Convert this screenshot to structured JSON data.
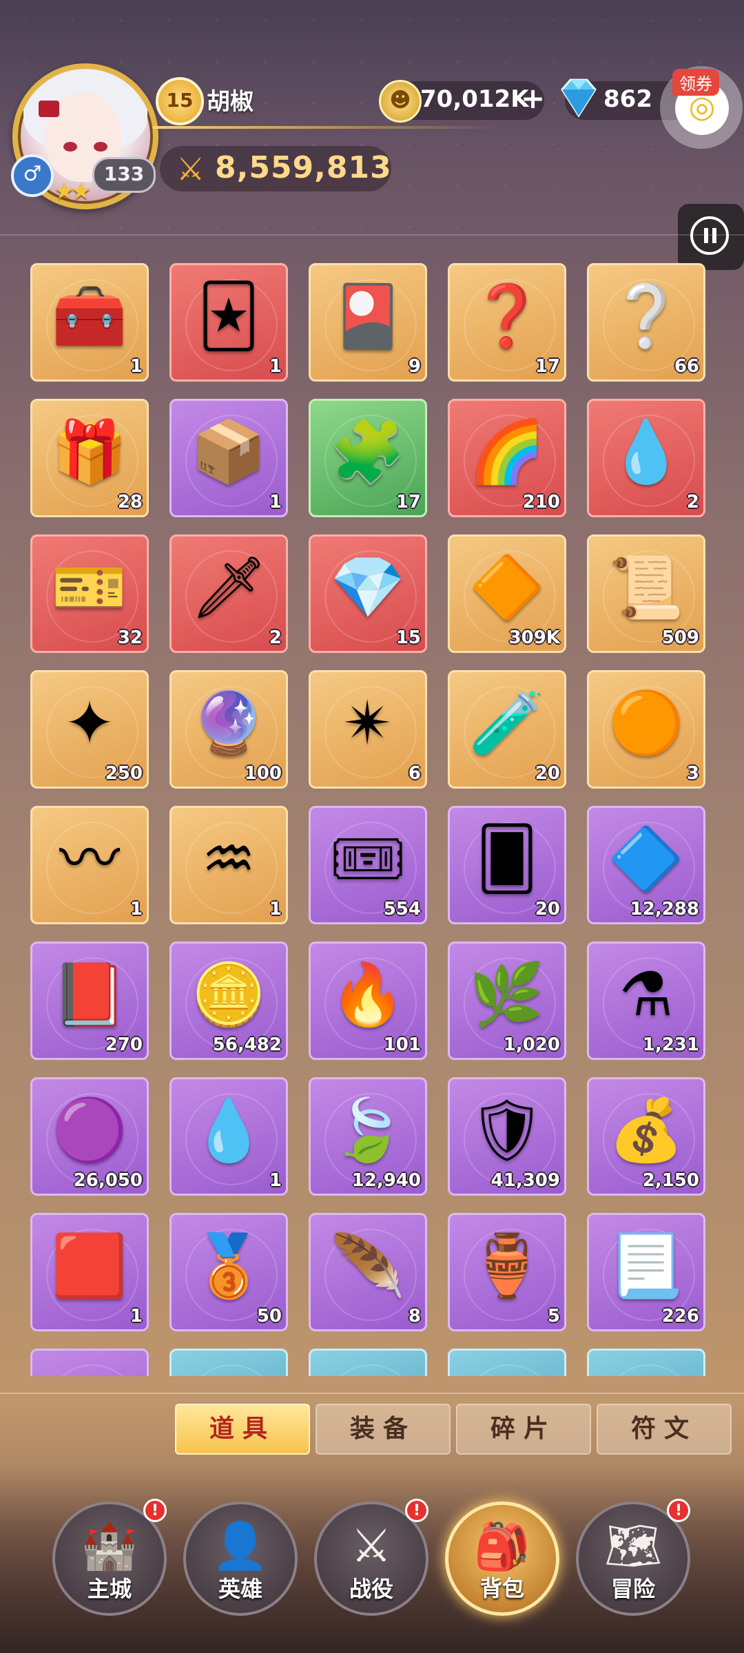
{
  "player": {
    "level": "15",
    "name": "胡椒",
    "hero_power_badge": "133",
    "total_power": "8,559,813"
  },
  "currency": {
    "gold": "70,012K",
    "gems": "862",
    "coupon_label": "领券"
  },
  "inventory": [
    {
      "icon": "treasure-chest",
      "glyph": "🧰",
      "count": "1",
      "rarity": "orange"
    },
    {
      "icon": "tarot-card",
      "glyph": "🃏",
      "count": "1",
      "rarity": "red"
    },
    {
      "icon": "hero-card-pack",
      "glyph": "🎴",
      "count": "9",
      "rarity": "orange"
    },
    {
      "icon": "mystery-card-pack",
      "glyph": "❓",
      "count": "17",
      "rarity": "orange"
    },
    {
      "icon": "mystery-card-pack-large",
      "glyph": "❔",
      "count": "66",
      "rarity": "orange"
    },
    {
      "icon": "golden-mystery-chest",
      "glyph": "🎁",
      "count": "28",
      "rarity": "orange"
    },
    {
      "icon": "purple-chest",
      "glyph": "📦",
      "count": "1",
      "rarity": "purple"
    },
    {
      "icon": "green-chest",
      "glyph": "🧩",
      "count": "17",
      "rarity": "green"
    },
    {
      "icon": "rainbow-card",
      "glyph": "🌈",
      "count": "210",
      "rarity": "red"
    },
    {
      "icon": "purple-drop",
      "glyph": "💧",
      "count": "2",
      "rarity": "red"
    },
    {
      "icon": "voucher-ticket",
      "glyph": "🎫",
      "count": "32",
      "rarity": "red"
    },
    {
      "icon": "spear",
      "glyph": "🗡",
      "count": "2",
      "rarity": "red"
    },
    {
      "icon": "blue-crystal",
      "glyph": "💎",
      "count": "15",
      "rarity": "red"
    },
    {
      "icon": "red-crystal",
      "glyph": "🔶",
      "count": "309K",
      "rarity": "orange"
    },
    {
      "icon": "summon-scroll",
      "glyph": "📜",
      "count": "509",
      "rarity": "orange"
    },
    {
      "icon": "blue-star",
      "glyph": "✦",
      "count": "250",
      "rarity": "orange"
    },
    {
      "icon": "purple-crystal-shard",
      "glyph": "🔮",
      "count": "100",
      "rarity": "orange"
    },
    {
      "icon": "rainbow-star",
      "glyph": "✴",
      "count": "6",
      "rarity": "orange"
    },
    {
      "icon": "potion-vial",
      "glyph": "🧪",
      "count": "20",
      "rarity": "orange"
    },
    {
      "icon": "amber-stone",
      "glyph": "🟠",
      "count": "3",
      "rarity": "orange"
    },
    {
      "icon": "blue-rune",
      "glyph": "〰",
      "count": "1",
      "rarity": "orange"
    },
    {
      "icon": "green-rune",
      "glyph": "♒",
      "count": "1",
      "rarity": "orange"
    },
    {
      "icon": "ticket-book",
      "glyph": "🎟",
      "count": "554",
      "rarity": "purple"
    },
    {
      "icon": "blue-summon-card",
      "glyph": "🂠",
      "count": "20",
      "rarity": "purple"
    },
    {
      "icon": "purple-shards",
      "glyph": "🔷",
      "count": "12,288",
      "rarity": "purple"
    },
    {
      "icon": "red-book",
      "glyph": "📕",
      "count": "270",
      "rarity": "purple"
    },
    {
      "icon": "gold-coin",
      "glyph": "🪙",
      "count": "56,482",
      "rarity": "purple"
    },
    {
      "icon": "campfire",
      "glyph": "🔥",
      "count": "101",
      "rarity": "purple"
    },
    {
      "icon": "golden-branch",
      "glyph": "🌿",
      "count": "1,020",
      "rarity": "purple"
    },
    {
      "icon": "potion-bottle",
      "glyph": "⚗",
      "count": "1,231",
      "rarity": "purple"
    },
    {
      "icon": "purple-gem",
      "glyph": "🟣",
      "count": "26,050",
      "rarity": "purple"
    },
    {
      "icon": "water-drop",
      "glyph": "💧",
      "count": "1",
      "rarity": "purple"
    },
    {
      "icon": "green-leaf",
      "glyph": "🍃",
      "count": "12,940",
      "rarity": "purple"
    },
    {
      "icon": "blue-medallion",
      "glyph": "🛡",
      "count": "41,309",
      "rarity": "purple"
    },
    {
      "icon": "gold-pouch",
      "glyph": "💰",
      "count": "2,150",
      "rarity": "purple"
    },
    {
      "icon": "carpet",
      "glyph": "🟥",
      "count": "1",
      "rarity": "purple"
    },
    {
      "icon": "bronze-coin",
      "glyph": "🥉",
      "count": "50",
      "rarity": "purple"
    },
    {
      "icon": "feather",
      "glyph": "🪶",
      "count": "8",
      "rarity": "purple"
    },
    {
      "icon": "jam-jar",
      "glyph": "🏺",
      "count": "5",
      "rarity": "purple"
    },
    {
      "icon": "super-scroll",
      "glyph": "📃",
      "count": "226",
      "rarity": "purple"
    },
    {
      "icon": "partial-item",
      "glyph": "",
      "count": "",
      "rarity": "purple"
    },
    {
      "icon": "partial-item",
      "glyph": "",
      "count": "",
      "rarity": "blue"
    },
    {
      "icon": "partial-item",
      "glyph": "",
      "count": "",
      "rarity": "blue"
    },
    {
      "icon": "partial-item",
      "glyph": "",
      "count": "",
      "rarity": "blue"
    },
    {
      "icon": "partial-item",
      "glyph": "",
      "count": "",
      "rarity": "blue"
    }
  ],
  "tabs": [
    {
      "label": "道具",
      "active": true
    },
    {
      "label": "装备",
      "active": false
    },
    {
      "label": "碎片",
      "active": false
    },
    {
      "label": "符文",
      "active": false
    }
  ],
  "nav": [
    {
      "label": "主城",
      "icon": "castle-icon",
      "glyph": "🏰",
      "alert": "!",
      "active": false
    },
    {
      "label": "英雄",
      "icon": "hero-icon",
      "glyph": "👤",
      "alert": "",
      "active": false
    },
    {
      "label": "战役",
      "icon": "sword-wings-icon",
      "glyph": "⚔",
      "alert": "!",
      "active": false
    },
    {
      "label": "背包",
      "icon": "backpack-icon",
      "glyph": "🎒",
      "alert": "",
      "active": true
    },
    {
      "label": "冒险",
      "icon": "adventure-icon",
      "glyph": "🗺",
      "alert": "!",
      "active": false
    }
  ]
}
